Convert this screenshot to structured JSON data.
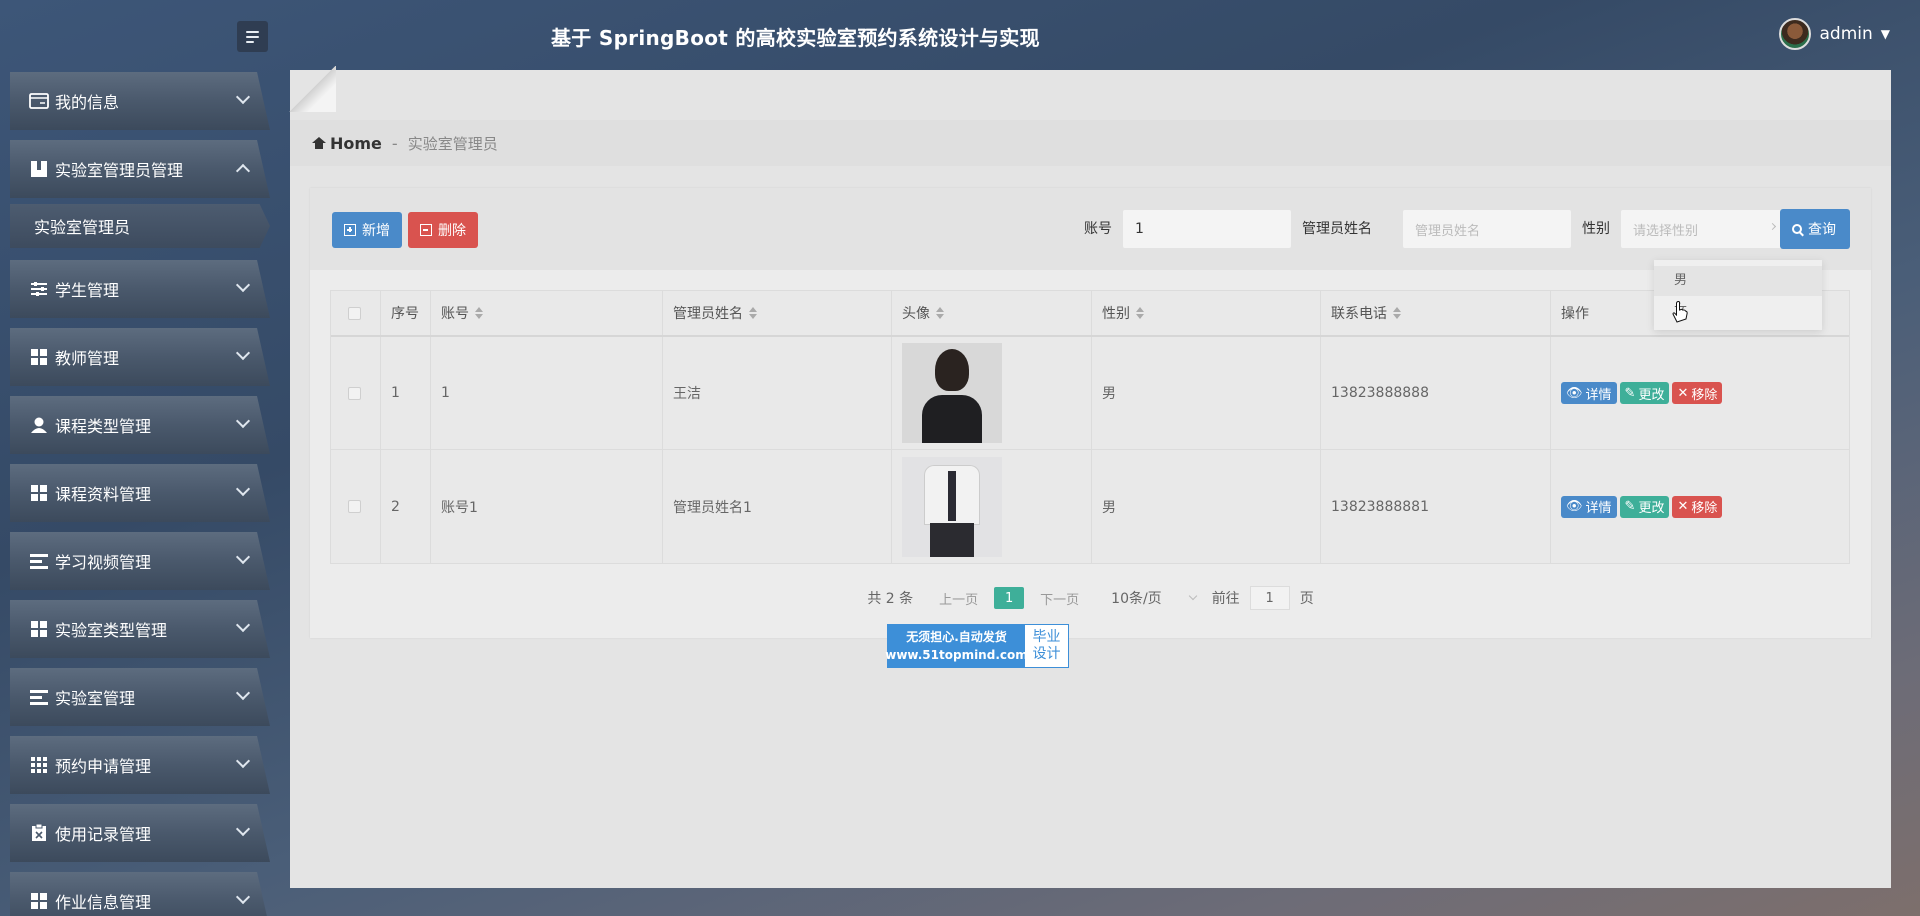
{
  "header": {
    "title": "基于 SpringBoot 的高校实验室预约系统设计与实现",
    "username": "admin"
  },
  "sidebar": {
    "items": [
      {
        "label": "我的信息",
        "icon": "id-card-icon",
        "expanded": false
      },
      {
        "label": "实验室管理员管理",
        "icon": "book-icon",
        "expanded": true
      },
      {
        "label": "实验室管理员",
        "icon": "",
        "sub": true
      },
      {
        "label": "学生管理",
        "icon": "sliders-icon",
        "expanded": false
      },
      {
        "label": "教师管理",
        "icon": "grid-icon",
        "expanded": false
      },
      {
        "label": "课程类型管理",
        "icon": "user-icon",
        "expanded": false
      },
      {
        "label": "课程资料管理",
        "icon": "grid-icon",
        "expanded": false
      },
      {
        "label": "学习视频管理",
        "icon": "list-icon",
        "expanded": false
      },
      {
        "label": "实验室类型管理",
        "icon": "grid-icon",
        "expanded": false
      },
      {
        "label": "实验室管理",
        "icon": "list-icon",
        "expanded": false
      },
      {
        "label": "预约申请管理",
        "icon": "apps-icon",
        "expanded": false
      },
      {
        "label": "使用记录管理",
        "icon": "clipboard-icon",
        "expanded": false
      },
      {
        "label": "作业信息管理",
        "icon": "grid-icon",
        "expanded": false
      }
    ]
  },
  "breadcrumb": {
    "home": "Home",
    "separator": "-",
    "current": "实验室管理员"
  },
  "toolbar": {
    "add_label": "新增",
    "delete_label": "删除",
    "search_label": "查询",
    "account_label": "账号",
    "account_value": "1",
    "name_label": "管理员姓名",
    "name_placeholder": "管理员姓名",
    "gender_label": "性别",
    "gender_placeholder": "请选择性别"
  },
  "gender_dropdown": {
    "options": [
      "男",
      "女"
    ]
  },
  "table": {
    "columns": [
      "序号",
      "账号",
      "管理员姓名",
      "头像",
      "性别",
      "联系电话",
      "操作"
    ],
    "rows": [
      {
        "no": "1",
        "account": "1",
        "name": "王洁",
        "gender": "男",
        "phone": "13823888888"
      },
      {
        "no": "2",
        "account": "账号1",
        "name": "管理员姓名1",
        "gender": "男",
        "phone": "13823888881"
      }
    ],
    "actions": {
      "detail": "详情",
      "edit": "更改",
      "remove": "移除"
    }
  },
  "watermark": {
    "line1": "无须担心.自动发货",
    "line2": "www.51topmind.com",
    "right1": "毕业",
    "right2": "设计"
  },
  "pagination": {
    "total": "共 2 条",
    "prev": "上一页",
    "current": "1",
    "next": "下一页",
    "page_size": "10条/页",
    "goto_label": "前往",
    "goto_value": "1",
    "page_unit": "页"
  },
  "colors": {
    "primary": "#4a8ac9",
    "success": "#3eaf99",
    "danger": "#d9534f"
  }
}
